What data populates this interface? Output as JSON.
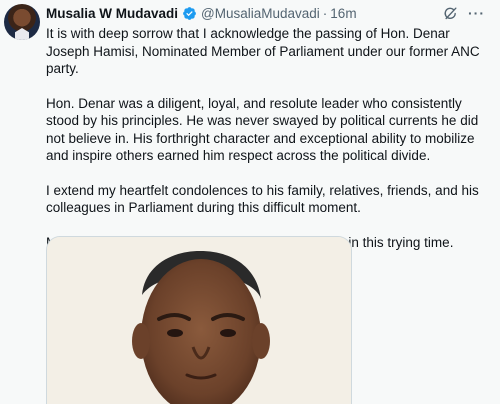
{
  "tweet": {
    "author_name": "Musalia W Mudavadi",
    "handle": "@MusaliaMudavadi",
    "separator": "·",
    "time": "16m",
    "paragraphs": [
      "It is with deep sorrow that I acknowledge the passing of Hon. Denar Joseph Hamisi, Nominated Member of Parliament under our former ANC party.",
      "Hon. Denar was a diligent, loyal, and resolute leader who consistently stood by his principles. He was never swayed by political currents he did not believe in. His forthright character and exceptional ability to mobilize and inspire others earned him respect across the political divide.",
      "I extend my heartfelt condolences to his family, relatives, friends, and his colleagues in Parliament during this difficult moment.",
      "May God grant them strength, comfort, and peace in this trying time."
    ],
    "more_label": "···"
  },
  "colors": {
    "text": "#0f1419",
    "secondary": "#536471",
    "verified": "#1d9bf0",
    "border": "#cfd9de",
    "background": "#f7f9f9"
  },
  "icons": {
    "verified": "verified-badge-icon",
    "grok": "grok-icon",
    "more": "more-options-icon"
  }
}
